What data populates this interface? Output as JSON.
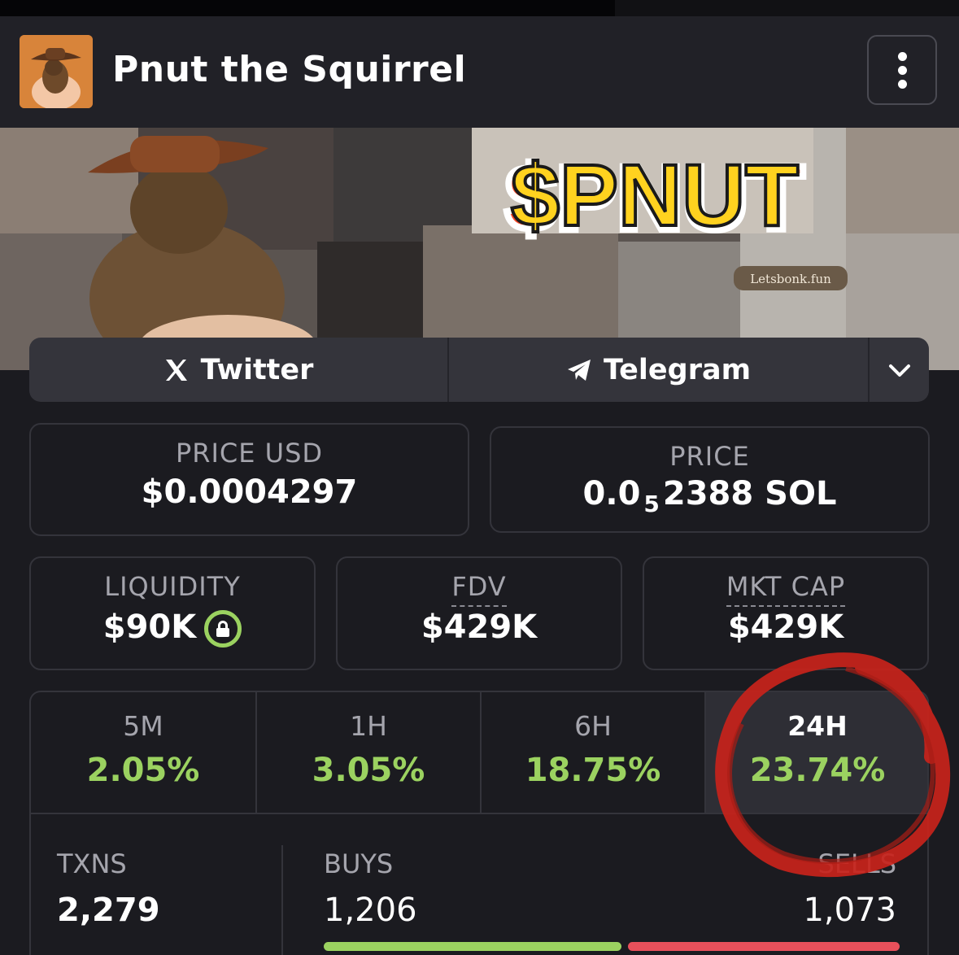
{
  "header": {
    "title": "Pnut the Squirrel"
  },
  "banner": {
    "headline": "$PNUT",
    "watermark": "Letsbonk.fun"
  },
  "links": {
    "twitter": "Twitter",
    "telegram": "Telegram"
  },
  "price_usd": {
    "label": "PRICE USD",
    "value": "$0.0004297"
  },
  "price_sol": {
    "label": "PRICE",
    "lead": "0.0",
    "zeros": "5",
    "rest": "2388 SOL"
  },
  "liquidity": {
    "label": "LIQUIDITY",
    "value": "$90K"
  },
  "fdv": {
    "label": "FDV",
    "value": "$429K"
  },
  "mkt_cap": {
    "label": "MKT CAP",
    "value": "$429K"
  },
  "timeframes": [
    {
      "label": "5M",
      "value": "2.05%"
    },
    {
      "label": "1H",
      "value": "3.05%"
    },
    {
      "label": "6H",
      "value": "18.75%"
    },
    {
      "label": "24H",
      "value": "23.74%"
    }
  ],
  "selected_timeframe": "24H",
  "stats": {
    "txns_label": "TXNS",
    "txns_value": "2,279",
    "buys_label": "BUYS",
    "buys_value": "1,206",
    "sells_label": "SELLS",
    "sells_value": "1,073"
  },
  "colors": {
    "positive": "#9bd260",
    "negative": "#e8505b",
    "annotation": "#c8231b"
  },
  "icons": [
    "x-logo-icon",
    "telegram-icon",
    "chevron-down-icon",
    "kebab-menu-icon",
    "lock-icon"
  ]
}
